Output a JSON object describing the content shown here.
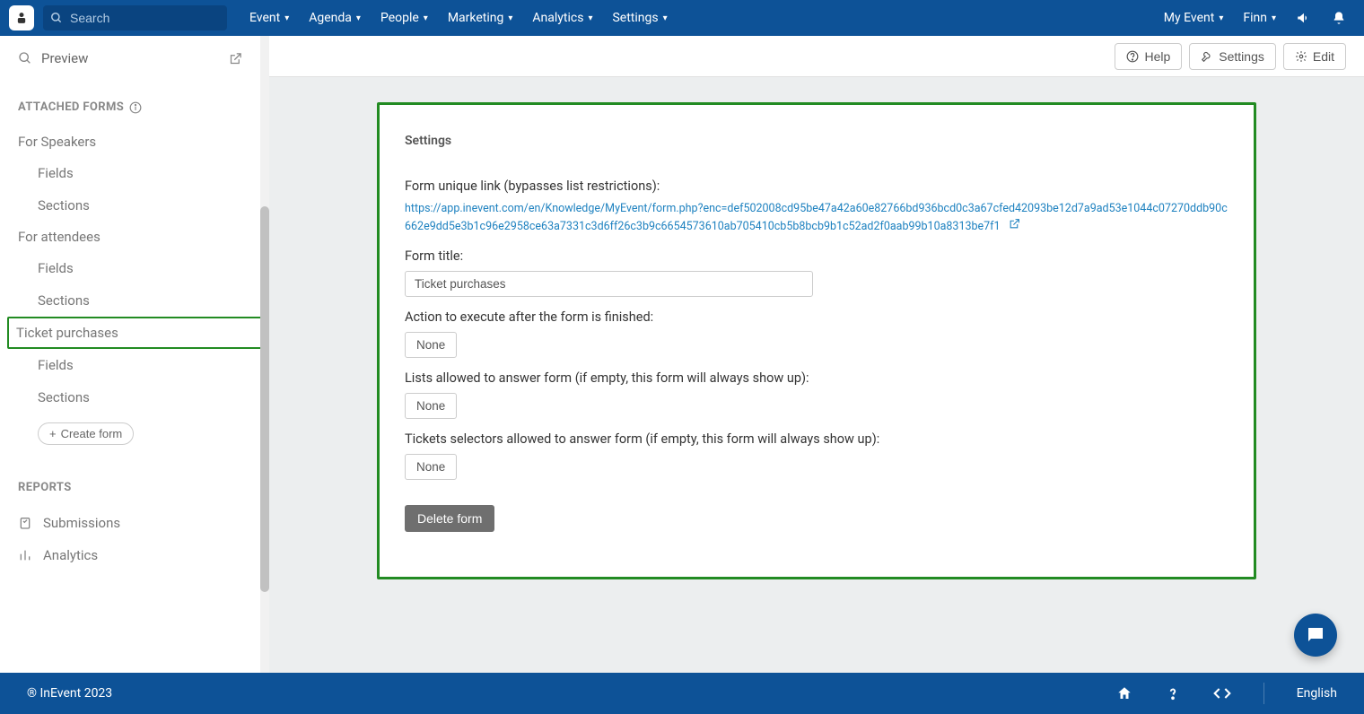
{
  "topnav": {
    "search_placeholder": "Search",
    "items": [
      "Event",
      "Agenda",
      "People",
      "Marketing",
      "Analytics",
      "Settings"
    ],
    "right": {
      "event": "My Event",
      "user": "Finn"
    }
  },
  "toolbar": {
    "help": "Help",
    "settings": "Settings",
    "edit": "Edit"
  },
  "sidebar": {
    "preview": "Preview",
    "attached_heading": "ATTACHED FORMS",
    "groups": [
      {
        "label": "For Speakers",
        "children": [
          "Fields",
          "Sections"
        ]
      },
      {
        "label": "For attendees",
        "children": [
          "Fields",
          "Sections"
        ]
      },
      {
        "label": "Ticket purchases",
        "selected": true,
        "children": [
          "Fields",
          "Sections"
        ]
      }
    ],
    "create_form": "Create form",
    "reports_heading": "REPORTS",
    "reports": [
      "Submissions",
      "Analytics"
    ]
  },
  "panel": {
    "title": "Settings",
    "unique_link_label": "Form unique link (bypasses list restrictions):",
    "unique_link": "https://app.inevent.com/en/Knowledge/MyEvent/form.php?enc=def502008cd95be47a42a60e82766bd936bcd0c3a67cfed42093be12d7a9ad53e1044c07270ddb90c662e9dd5e3b1c96e2958ce63a7331c3d6ff26c3b9c6654573610ab705410cb5b8bcb9b1c52ad2f0aab99b10a8313be7f1",
    "form_title_label": "Form title:",
    "form_title_value": "Ticket purchases",
    "action_label": "Action to execute after the form is finished:",
    "action_value": "None",
    "lists_label": "Lists allowed to answer form (if empty, this form will always show up):",
    "lists_value": "None",
    "tickets_label": "Tickets selectors allowed to answer form (if empty, this form will always show up):",
    "tickets_value": "None",
    "delete": "Delete form"
  },
  "footer": {
    "copyright": "® InEvent 2023",
    "language": "English"
  }
}
